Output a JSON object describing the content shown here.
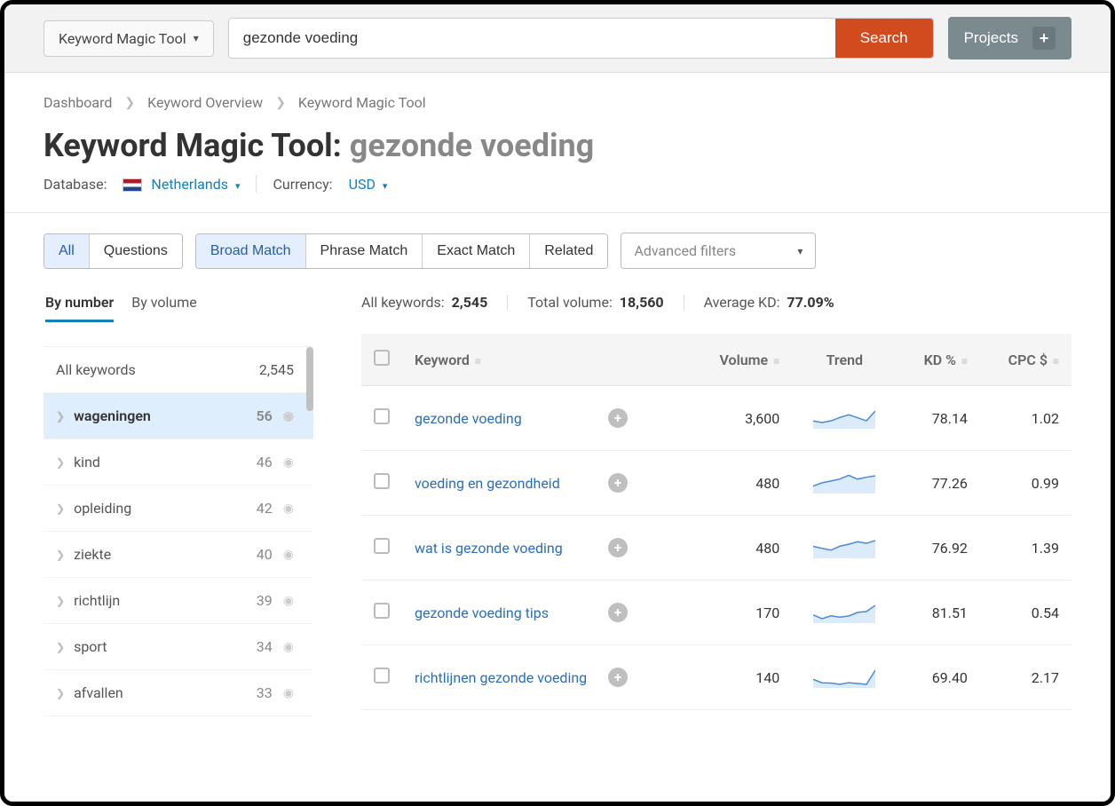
{
  "topbar": {
    "tool_dropdown_label": "Keyword Magic Tool",
    "search_value": "gezonde voeding",
    "search_button": "Search",
    "projects_button": "Projects"
  },
  "breadcrumb": {
    "items": [
      "Dashboard",
      "Keyword Overview",
      "Keyword Magic Tool"
    ]
  },
  "header": {
    "title_prefix": "Keyword Magic Tool: ",
    "query": "gezonde voeding",
    "database_label": "Database:",
    "database_value": "Netherlands",
    "currency_label": "Currency:",
    "currency_value": "USD"
  },
  "filters": {
    "scope": {
      "all": "All",
      "questions": "Questions"
    },
    "match": {
      "broad": "Broad Match",
      "phrase": "Phrase Match",
      "exact": "Exact Match",
      "related": "Related"
    },
    "advanced": "Advanced filters"
  },
  "subtabs": {
    "by_number": "By number",
    "by_volume": "By volume"
  },
  "stats": {
    "all_keywords_label": "All keywords:",
    "all_keywords_value": "2,545",
    "total_volume_label": "Total volume:",
    "total_volume_value": "18,560",
    "avg_kd_label": "Average KD:",
    "avg_kd_value": "77.09%"
  },
  "groups": {
    "all_label": "All keywords",
    "all_count": "2,545",
    "items": [
      {
        "label": "wageningen",
        "count": "56"
      },
      {
        "label": "kind",
        "count": "46"
      },
      {
        "label": "opleiding",
        "count": "42"
      },
      {
        "label": "ziekte",
        "count": "40"
      },
      {
        "label": "richtlijn",
        "count": "39"
      },
      {
        "label": "sport",
        "count": "34"
      },
      {
        "label": "afvallen",
        "count": "33"
      }
    ]
  },
  "table": {
    "columns": {
      "keyword": "Keyword",
      "volume": "Volume",
      "trend": "Trend",
      "kd": "KD %",
      "cpc": "CPC $"
    },
    "rows": [
      {
        "keyword": "gezonde voeding",
        "volume": "3,600",
        "kd": "78.14",
        "cpc": "1.02"
      },
      {
        "keyword": "voeding en gezondheid",
        "volume": "480",
        "kd": "77.26",
        "cpc": "0.99"
      },
      {
        "keyword": "wat is gezonde voeding",
        "volume": "480",
        "kd": "76.92",
        "cpc": "1.39"
      },
      {
        "keyword": "gezonde voeding tips",
        "volume": "170",
        "kd": "81.51",
        "cpc": "0.54"
      },
      {
        "keyword": "richtlijnen gezonde voeding",
        "volume": "140",
        "kd": "69.40",
        "cpc": "2.17"
      }
    ]
  }
}
